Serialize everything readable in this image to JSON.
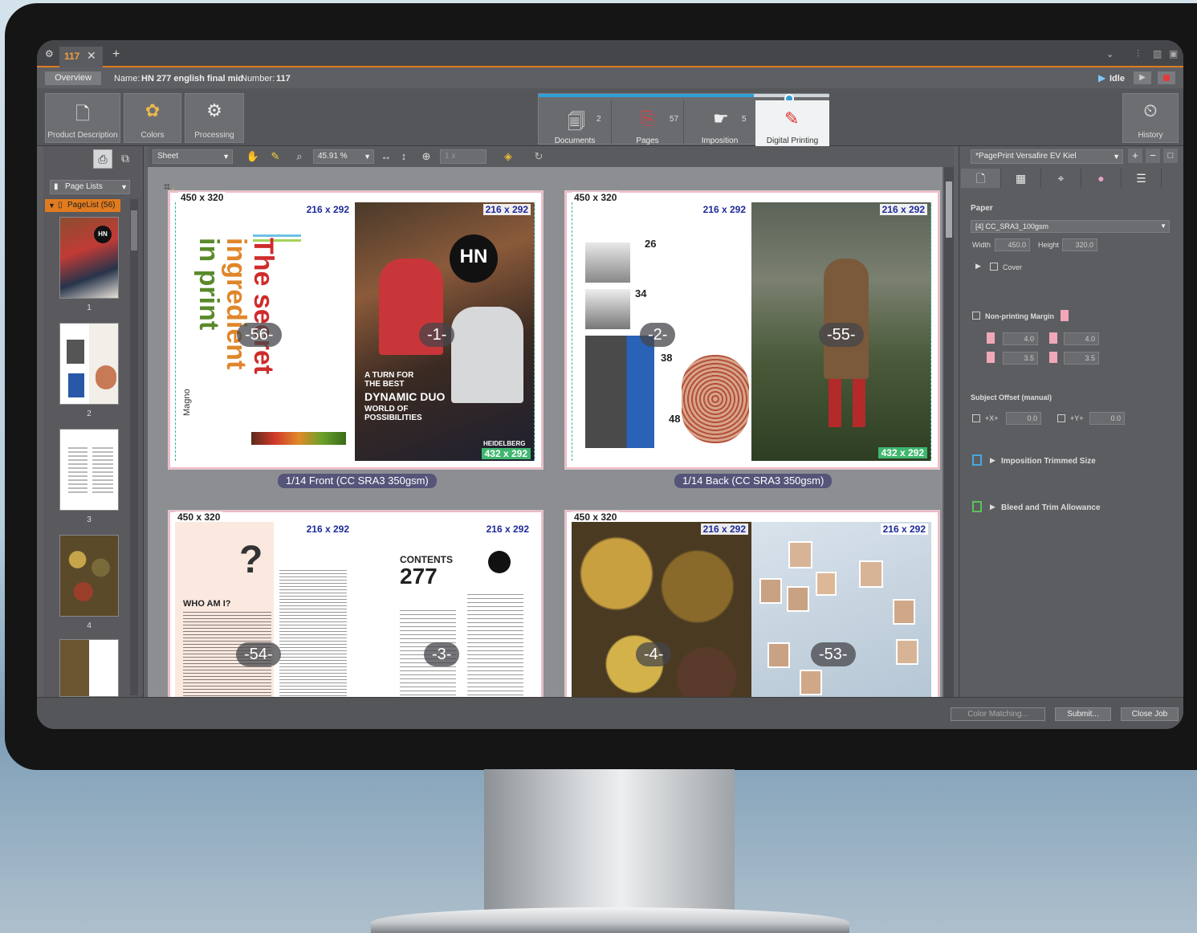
{
  "window": {
    "tab_number": "117",
    "tab_close": "✕",
    "new_tab": "+"
  },
  "infobar": {
    "overview": "Overview",
    "name_label": "Name:",
    "name_value": "HN 277 english final mid",
    "number_label": "Number:",
    "number_value": "117",
    "status": "Idle"
  },
  "toolbar": {
    "product_description": "Product Description",
    "colors": "Colors",
    "processing": "Processing",
    "history": "History"
  },
  "workflow": [
    {
      "label": "Documents",
      "count": "2"
    },
    {
      "label": "Pages",
      "count": "57"
    },
    {
      "label": "Imposition",
      "count": "5"
    },
    {
      "label": "Digital Printing",
      "count": ""
    }
  ],
  "subtoolbar": {
    "view_select": "Sheet",
    "zoom": "45.91 %",
    "scale": "1 x"
  },
  "left_panel": {
    "selector": "Page Lists",
    "list_item": "PageList (56)",
    "thumb_numbers": [
      "1",
      "2",
      "3",
      "4"
    ]
  },
  "sheets": [
    {
      "size": "450 x 320",
      "pages": [
        {
          "size": "216 x 292",
          "number": "-56-",
          "text": [
            "The secret",
            "ingredient",
            "in print"
          ],
          "side_text": "Magno"
        },
        {
          "size": "216 x 292",
          "number": "-1-",
          "logo": "HN",
          "headline": "DYNAMIC DUO",
          "lines": [
            "A TURN FOR",
            "THE BEST",
            "WORLD OF",
            "POSSIBILITIES"
          ],
          "brand": "HEIDELBERG"
        }
      ],
      "trim": "432 x 292",
      "caption": "1/14 Front (CC SRA3 350gsm)"
    },
    {
      "size": "450 x 320",
      "pages": [
        {
          "size": "216 x 292",
          "number": "-2-",
          "page_refs": [
            "26",
            "34",
            "38",
            "48"
          ]
        },
        {
          "size": "216 x 292",
          "number": "-55-"
        }
      ],
      "trim": "432 x 292",
      "caption": "1/14 Back (CC SRA3 350gsm)"
    },
    {
      "size": "450 x 320",
      "pages": [
        {
          "size": "216 x 292",
          "number": "-54-",
          "text": [
            "WHO AM I?"
          ]
        },
        {
          "size": "216 x 292",
          "number": "-3-",
          "text": [
            "CONTENTS",
            "277"
          ]
        }
      ]
    },
    {
      "size": "450 x 320",
      "pages": [
        {
          "size": "216 x 292",
          "number": "-4-"
        },
        {
          "size": "216 x 292",
          "number": "-53-"
        }
      ]
    }
  ],
  "right_panel": {
    "device": "*PagePrint Versafire EV Kiel",
    "paper_label": "Paper",
    "paper_value": "[4] CC_SRA3_100gsm",
    "width_label": "Width",
    "width_value": "450.0",
    "height_label": "Height",
    "height_value": "320.0",
    "cover": "Cover",
    "non_printing_margin": "Non-printing Margin",
    "margins": [
      "4.0",
      "4.0",
      "3.5",
      "3.5"
    ],
    "subject_offset": "Subject Offset (manual)",
    "x_label": "+X+",
    "x_value": "0.0",
    "y_label": "+Y+",
    "y_value": "0.0",
    "imposition_trimmed": "Imposition Trimmed Size",
    "bleed_trim": "Bleed and Trim Allowance"
  },
  "bottom": {
    "color_matching": "Color Matching...",
    "submit": "Submit...",
    "close_job": "Close Job"
  },
  "colors": {
    "accent": "#e07b1f",
    "page_dim": "#1d2a9a",
    "trim_green": "#3fb76f",
    "sheet_border": "#f3b8c6"
  }
}
